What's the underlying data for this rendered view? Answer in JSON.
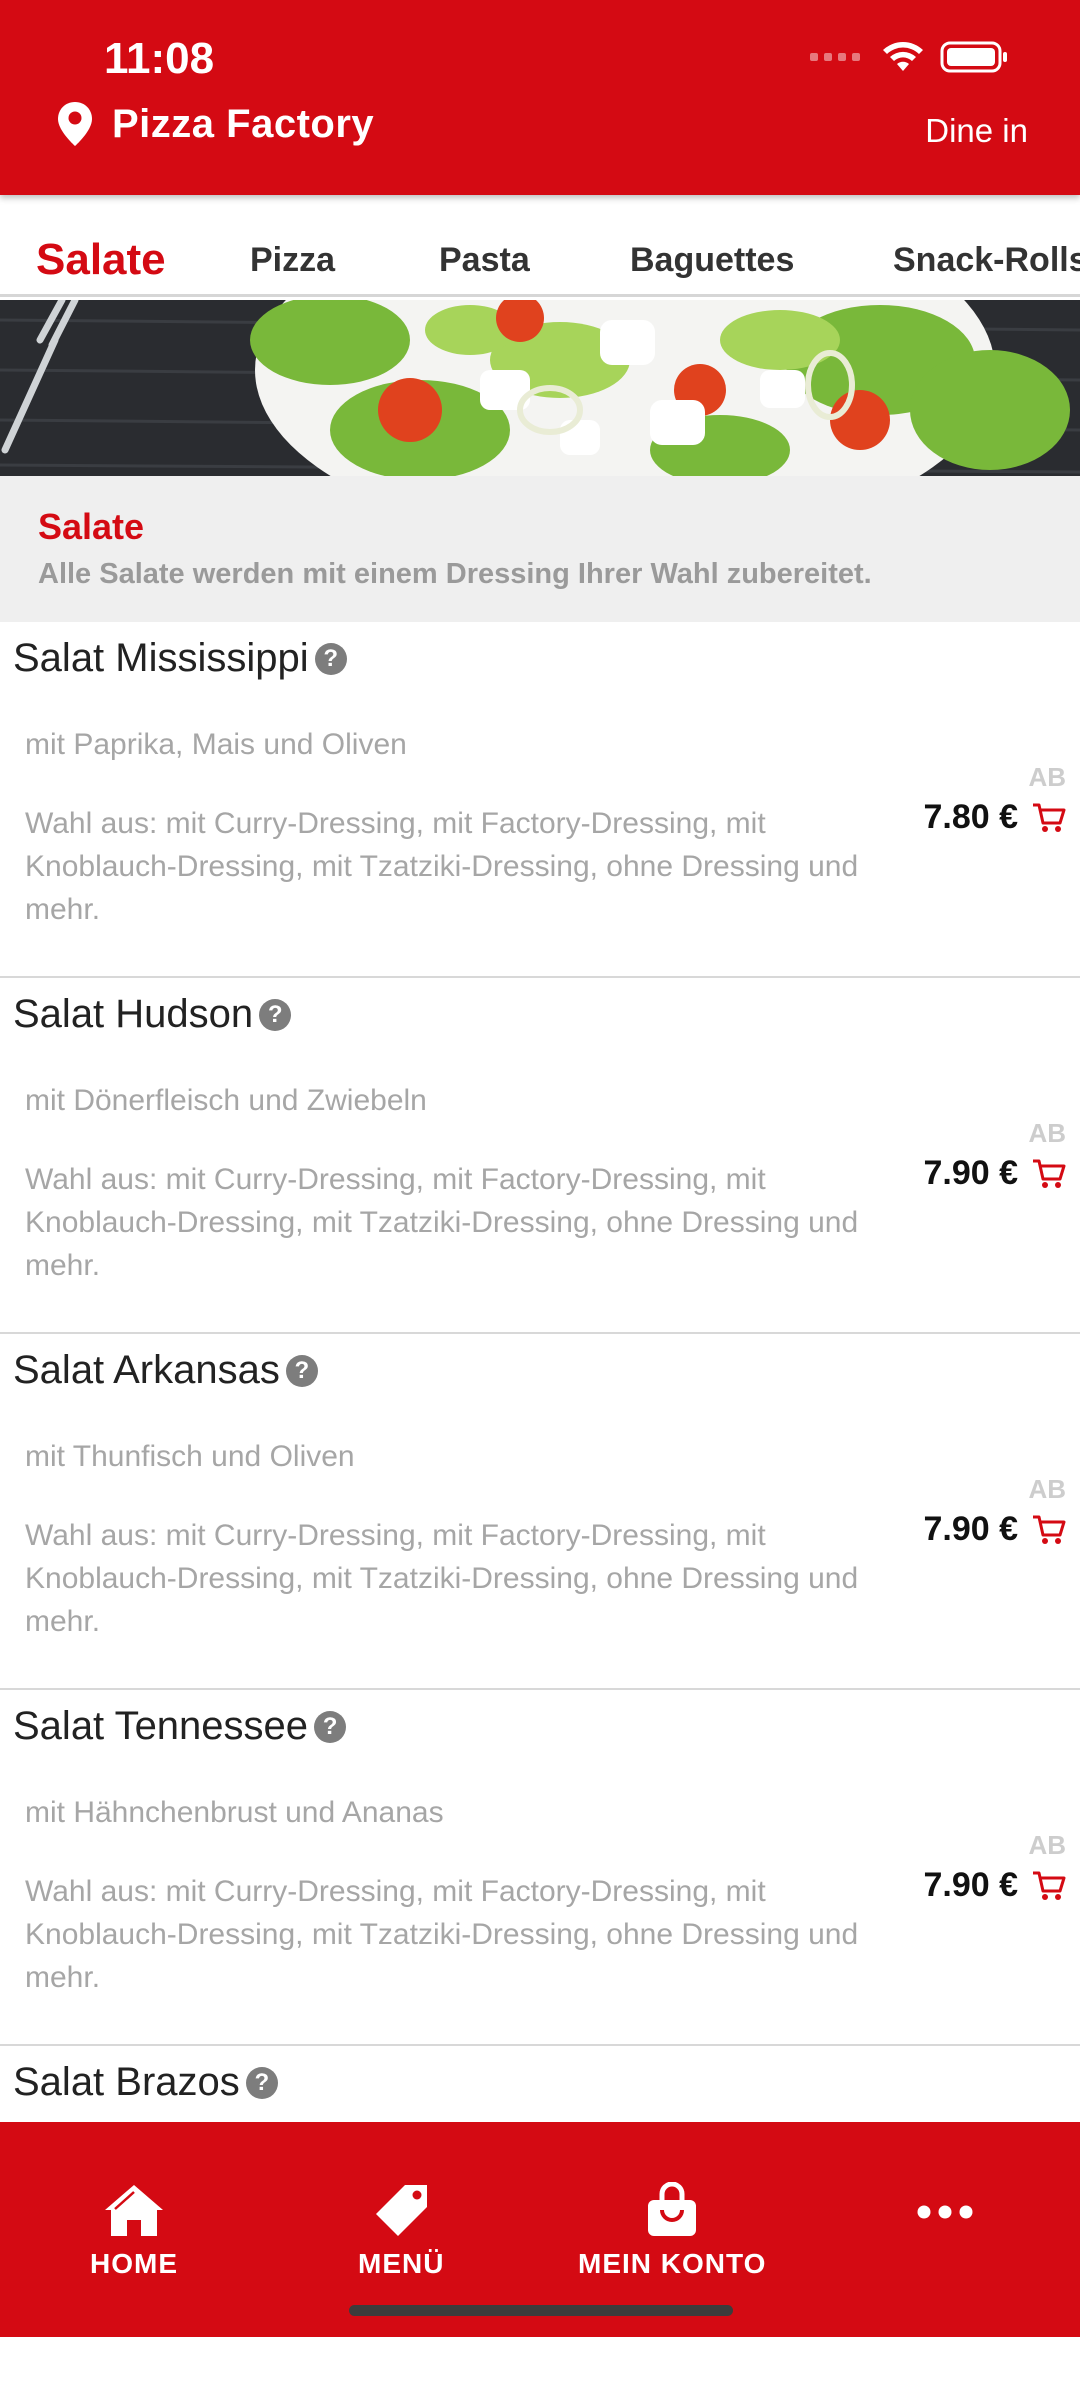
{
  "status_bar": {
    "time": "11:08"
  },
  "header": {
    "restaurant_name": "Pizza Factory",
    "order_mode": "Dine in"
  },
  "tabs": [
    {
      "label": "Salate",
      "active": true
    },
    {
      "label": "Pizza",
      "active": false
    },
    {
      "label": "Pasta",
      "active": false
    },
    {
      "label": "Baguettes",
      "active": false
    },
    {
      "label": "Snack-Rolls",
      "active": false
    }
  ],
  "section": {
    "title": "Salate",
    "subtitle": "Alle Salate werden mit einem Dressing Ihrer Wahl zubereitet."
  },
  "products": [
    {
      "name": "Salat Mississippi",
      "description": "mit Paprika, Mais und Oliven",
      "choice": "Wahl aus: mit Curry-Dressing, mit Factory-Dressing, mit Knoblauch-Dressing, mit Tzatziki-Dressing, ohne Dressing und mehr.",
      "price_prefix": "AB",
      "price": "7.80 €"
    },
    {
      "name": "Salat Hudson",
      "description": "mit Dönerfleisch und Zwiebeln",
      "choice": "Wahl aus: mit Curry-Dressing, mit Factory-Dressing, mit Knoblauch-Dressing, mit Tzatziki-Dressing, ohne Dressing und mehr.",
      "price_prefix": "AB",
      "price": "7.90 €"
    },
    {
      "name": "Salat Arkansas",
      "description": "mit Thunfisch und Oliven",
      "choice": "Wahl aus: mit Curry-Dressing, mit Factory-Dressing, mit Knoblauch-Dressing, mit Tzatziki-Dressing, ohne Dressing und mehr.",
      "price_prefix": "AB",
      "price": "7.90 €"
    },
    {
      "name": "Salat Tennessee",
      "description": "mit Hähnchenbrust und Ananas",
      "choice": "Wahl aus: mit Curry-Dressing, mit Factory-Dressing, mit Knoblauch-Dressing, mit Tzatziki-Dressing, ohne Dressing und mehr.",
      "price_prefix": "AB",
      "price": "7.90 €"
    },
    {
      "name": "Salat Brazos"
    }
  ],
  "bottom_nav": [
    {
      "label": "HOME",
      "icon": "home-icon"
    },
    {
      "label": "MENÜ",
      "icon": "tag-icon"
    },
    {
      "label": "MEIN KONTO",
      "icon": "shopping-bag-icon"
    },
    {
      "label": "",
      "icon": "more-icon"
    }
  ],
  "colors": {
    "brand_red": "#d40a13",
    "section_bg": "#efefef",
    "muted_text": "#a6a6a6"
  }
}
